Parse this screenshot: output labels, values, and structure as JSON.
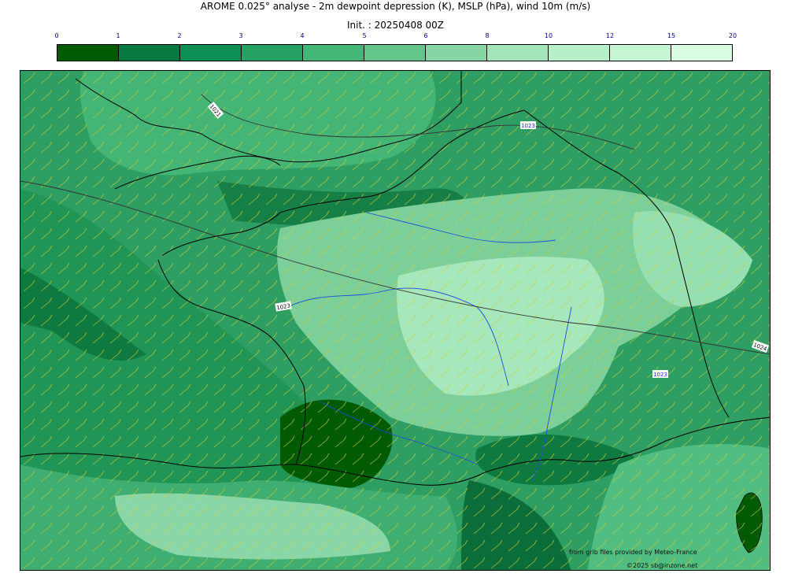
{
  "title": "AROME 0.025° analyse - 2m dewpoint depression (K), MSLP (hPa), wind 10m (m/s)",
  "init": "Init. : 20250408 00Z",
  "colorbar": {
    "ticks": [
      "0",
      "1",
      "2",
      "3",
      "4",
      "5",
      "6",
      "8",
      "10",
      "12",
      "15",
      "20"
    ],
    "colors": [
      "#005a00",
      "#087a3f",
      "#0e8f55",
      "#27a163",
      "#43b676",
      "#64c58a",
      "#86d6a4",
      "#a2e5b8",
      "#b7efc8",
      "#c6f5d3",
      "#d8fbe2"
    ]
  },
  "pressure_labels": [
    "1021",
    "1023",
    "1023",
    "1023",
    "1024"
  ],
  "credit_source": "from grib files provided by Meteo-France",
  "credit_copyright": "©2025 sb@inzone.net"
}
